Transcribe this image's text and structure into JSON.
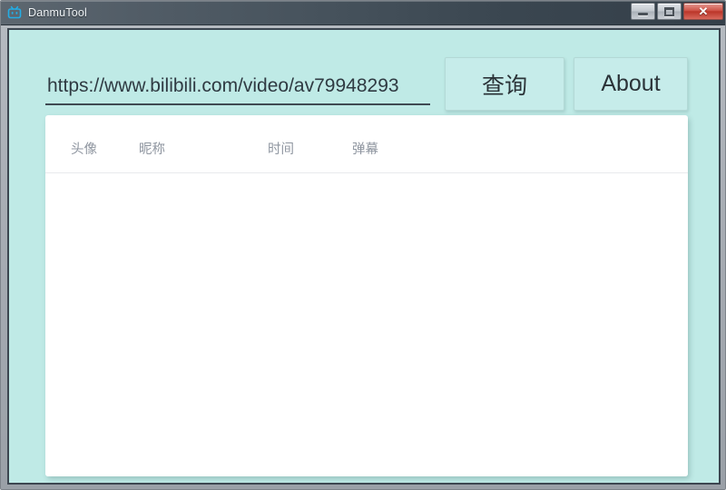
{
  "window": {
    "title": "DanmuTool",
    "icon": "bilibili-tv-icon",
    "background_color": "#bfeae6",
    "titlebar_color": "#46525c",
    "controls": {
      "minimize_label": "Minimize",
      "maximize_label": "Maximize",
      "close_label": "✕"
    }
  },
  "toolbar": {
    "url_value": "https://www.bilibili.com/video/av79948293",
    "url_placeholder": "https://www.bilibili.com/video/av...",
    "query_label": "查询",
    "about_label": "About"
  },
  "table": {
    "columns": [
      {
        "key": "avatar",
        "label": "头像"
      },
      {
        "key": "nickname",
        "label": "昵称"
      },
      {
        "key": "time",
        "label": "时间"
      },
      {
        "key": "danmu",
        "label": "弹幕"
      }
    ],
    "rows": []
  }
}
